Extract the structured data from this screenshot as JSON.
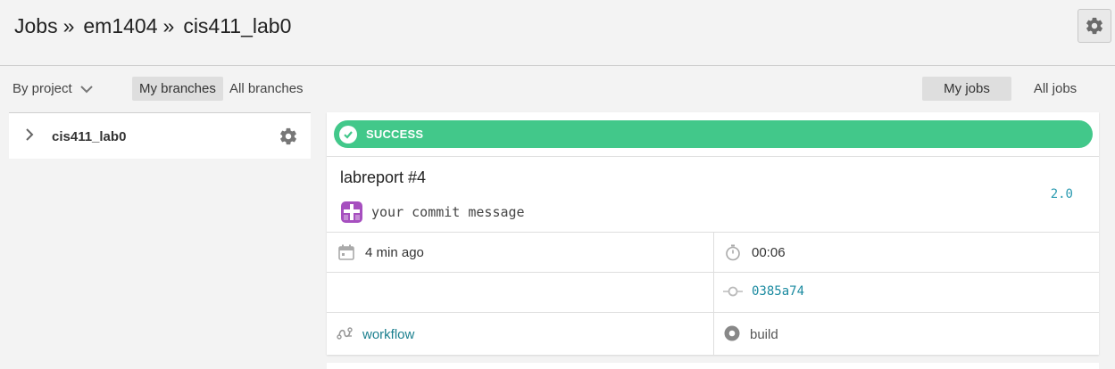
{
  "breadcrumb": {
    "items": [
      "Jobs",
      "em1404",
      "cis411_lab0"
    ],
    "separator": "»"
  },
  "filters": {
    "by_project": "By project",
    "my_branches": "My branches",
    "all_branches": "All branches",
    "my_jobs": "My jobs",
    "all_jobs": "All jobs"
  },
  "project": {
    "name": "cis411_lab0"
  },
  "job": {
    "status": "SUCCESS",
    "title": "labreport #4",
    "version": "2.0",
    "commit_message": "your commit message",
    "time_ago": "4 min ago",
    "duration": "00:06",
    "commit_hash": "0385a74",
    "workflow": "workflow",
    "job_name": "build"
  },
  "colors": {
    "success": "#42c88a",
    "link": "#1a7f8e",
    "avatar": "#a64fbf"
  },
  "icons": [
    "gear-icon",
    "chevron-down-icon",
    "chevron-right-icon",
    "check-circle-icon",
    "calendar-icon",
    "stopwatch-icon",
    "commit-icon",
    "workflow-icon",
    "job-circle-icon"
  ]
}
